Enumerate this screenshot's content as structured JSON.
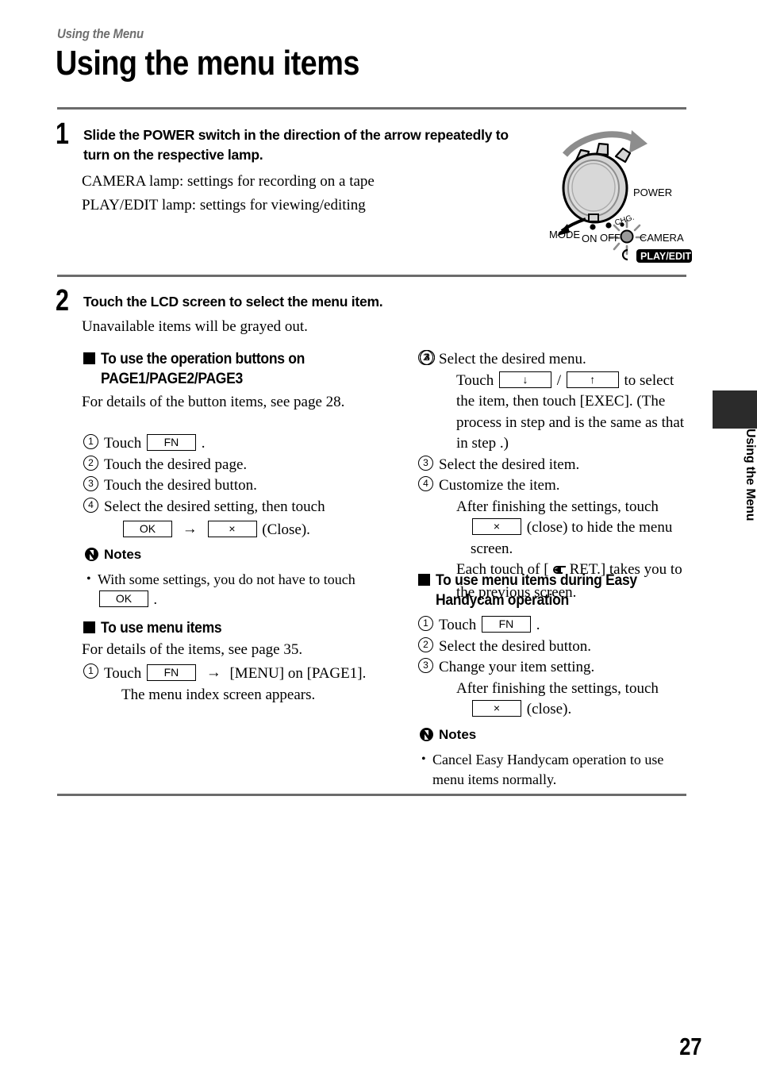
{
  "header": {
    "kicker": "Using the Menu",
    "title": "Using the menu items"
  },
  "steps": [
    {
      "number": "1",
      "heading": "Slide the POWER switch in the direction of the arrow repeatedly to turn on the respective lamp.",
      "body_lines": [
        "CAMERA lamp: settings for recording on a tape",
        "PLAY/EDIT lamp: settings for viewing/editing"
      ]
    },
    {
      "number": "2",
      "heading": "Touch the LCD screen to select the menu item.",
      "body_lines": [
        "Unavailable items will be grayed out."
      ]
    }
  ],
  "dial": {
    "label_power": "POWER",
    "label_mode": "MODE",
    "label_on": "ON",
    "label_off": "OFF",
    "label_chg": "CHG.",
    "label_camera": "CAMERA",
    "label_playedit": "PLAY/EDIT"
  },
  "left_column": {
    "section1": {
      "heading_line1": "To use the operation buttons on",
      "heading_line2": "PAGE1/PAGE2/PAGE3",
      "intro": "For details of the button items, see page 28.",
      "items": [
        {
          "num": "1",
          "text_before": "Touch",
          "key": "FN",
          "text_after": "."
        },
        {
          "num": "2",
          "text_before": "Touch the desired page.",
          "key": "",
          "text_after": ""
        },
        {
          "num": "3",
          "text_before": "Touch the desired button.",
          "key": "",
          "text_after": ""
        },
        {
          "num": "4",
          "text_before": "Select the desired setting, then touch",
          "key": "",
          "text_after": ""
        }
      ],
      "item4_key_ok": "OK",
      "item4_arrow": "→",
      "item4_key_close": "×",
      "item4_suffix": "(Close)."
    },
    "notes1": {
      "title": "Notes",
      "bullet_before": "With some settings, you do not have to touch",
      "bullet_key": "OK",
      "bullet_after": "."
    },
    "section2": {
      "heading_line1": "To use menu items",
      "intro": "For details of the items, see page 35.",
      "item1_num": "1",
      "item1_before": "Touch",
      "item1_key": "FN",
      "item1_arrow": "→",
      "item1_after": "[MENU] on [PAGE1].",
      "item1_sub": "The menu index screen appears."
    }
  },
  "right_column": {
    "section_continue": {
      "item2_num": "2",
      "item2_text": "Select the desired menu.",
      "item2_sub_before": "Touch",
      "item2_key_down": "↓",
      "item2_slash": "/",
      "item2_key_up": "↑",
      "item2_sub_after": "to select the item, then touch [EXEC]. (The process in step",
      "item2_and": "and",
      "item2_sub_tail": "is the same as that in step",
      "item2_sub_end": ".)",
      "ref_num_3": "3",
      "ref_num_4": "4",
      "ref_num_2": "2",
      "item3_num": "3",
      "item3_text": "Select the desired item.",
      "item4_num": "4",
      "item4_text": "Customize the item.",
      "item4_sub1": "After finishing the settings, touch",
      "item4_key_close": "×",
      "item4_sub2": "(close) to hide the menu screen.",
      "item4_sub3_before": "Each touch of [",
      "item4_sub3_ret": "RET.] takes you to the previous screen."
    },
    "section3": {
      "heading_line1": "To use menu items during Easy",
      "heading_line2": "Handycam operation",
      "items": [
        {
          "num": "1",
          "text": "Touch",
          "key": "FN",
          "after": "."
        },
        {
          "num": "2",
          "text": "Select the desired button.",
          "key": "",
          "after": ""
        },
        {
          "num": "3",
          "text": "Change your item setting.",
          "key": "",
          "after": ""
        }
      ],
      "item3_sub1": "After finishing the settings, touch",
      "item3_key_close": "×",
      "item3_sub2": "(close)."
    },
    "notes2": {
      "title": "Notes",
      "bullet": "Cancel Easy Handycam operation to use menu items normally."
    }
  },
  "side_tab": {
    "label": "Using the Menu"
  },
  "footer": {
    "page_number": "27"
  }
}
